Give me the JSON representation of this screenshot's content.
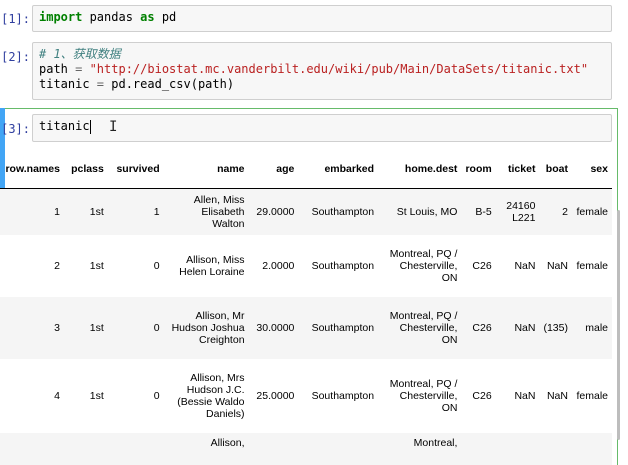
{
  "cells": [
    {
      "prompt": "[1]:",
      "kw1": "import",
      "mod": " pandas ",
      "kw2": "as",
      "alias": " pd"
    },
    {
      "prompt": "[2]:",
      "comment": "# 1、获取数据",
      "line2_var": "path ",
      "line2_eq": "=",
      "line2_str": " \"http://biostat.mc.vanderbilt.edu/wiki/pub/Main/DataSets/titanic.txt\"",
      "line3": "titanic ",
      "line3_eq": "=",
      "line3_rest": " pd.read_csv(path)"
    },
    {
      "prompt": "[3]:",
      "code": "titanic"
    }
  ],
  "table": {
    "columns": [
      "row.names",
      "pclass",
      "survived",
      "name",
      "age",
      "embarked",
      "home.dest",
      "room",
      "ticket",
      "boat",
      "sex"
    ],
    "rows": [
      {
        "row_names": "1",
        "pclass": "1st",
        "survived": "1",
        "name": "Allen, Miss Elisabeth Walton",
        "age": "29.0000",
        "embarked": "Southampton",
        "home_dest": "St Louis, MO",
        "room": "B-5",
        "ticket": "24160 L221",
        "boat": "2",
        "sex": "female"
      },
      {
        "row_names": "2",
        "pclass": "1st",
        "survived": "0",
        "name": "Allison, Miss Helen Loraine",
        "age": "2.0000",
        "embarked": "Southampton",
        "home_dest": "Montreal, PQ / Chesterville, ON",
        "room": "C26",
        "ticket": "NaN",
        "boat": "NaN",
        "sex": "female"
      },
      {
        "row_names": "3",
        "pclass": "1st",
        "survived": "0",
        "name": "Allison, Mr Hudson Joshua Creighton",
        "age": "30.0000",
        "embarked": "Southampton",
        "home_dest": "Montreal, PQ / Chesterville, ON",
        "room": "C26",
        "ticket": "NaN",
        "boat": "(135)",
        "sex": "male"
      },
      {
        "row_names": "4",
        "pclass": "1st",
        "survived": "0",
        "name": "Allison, Mrs Hudson J.C. (Bessie Waldo Daniels)",
        "age": "25.0000",
        "embarked": "Southampton",
        "home_dest": "Montreal, PQ / Chesterville, ON",
        "room": "C26",
        "ticket": "NaN",
        "boat": "NaN",
        "sex": "female"
      },
      {
        "row_names": "",
        "pclass": "",
        "survived": "",
        "name": "Allison,",
        "age": "",
        "embarked": "",
        "home_dest": "Montreal,",
        "room": "",
        "ticket": "",
        "boat": "",
        "sex": ""
      }
    ]
  },
  "colors": {
    "selected_border": "#66bb6a",
    "selected_bar": "#42a5f5",
    "prompt": "#303f9f"
  }
}
